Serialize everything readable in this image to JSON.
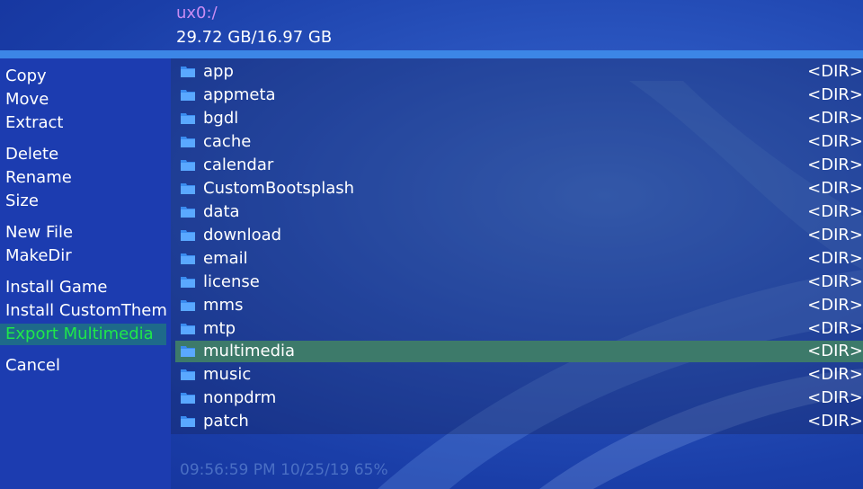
{
  "header": {
    "path": "ux0:/",
    "storage": "29.72 GB/16.97 GB"
  },
  "menu": {
    "items": [
      {
        "label": "Copy",
        "selected": false
      },
      {
        "label": "Move",
        "selected": false
      },
      {
        "label": "Extract",
        "selected": false
      },
      {
        "label": "Delete",
        "selected": false
      },
      {
        "label": "Rename",
        "selected": false
      },
      {
        "label": "Size",
        "selected": false
      },
      {
        "label": "New File",
        "selected": false
      },
      {
        "label": "MakeDir",
        "selected": false
      },
      {
        "label": "Install Game",
        "selected": false
      },
      {
        "label": "Install CustomTheme",
        "selected": false
      },
      {
        "label": "Export Multimedia",
        "selected": true
      },
      {
        "label": "Cancel",
        "selected": false
      }
    ]
  },
  "files": {
    "items": [
      {
        "name": "app",
        "type": "<DIR>",
        "icon": "folder-icon"
      },
      {
        "name": "appmeta",
        "type": "<DIR>",
        "icon": "folder-icon"
      },
      {
        "name": "bgdl",
        "type": "<DIR>",
        "icon": "folder-icon"
      },
      {
        "name": "cache",
        "type": "<DIR>",
        "icon": "folder-icon"
      },
      {
        "name": "calendar",
        "type": "<DIR>",
        "icon": "folder-icon"
      },
      {
        "name": "CustomBootsplash",
        "type": "<DIR>",
        "icon": "folder-icon"
      },
      {
        "name": "data",
        "type": "<DIR>",
        "icon": "folder-icon"
      },
      {
        "name": "download",
        "type": "<DIR>",
        "icon": "folder-icon"
      },
      {
        "name": "email",
        "type": "<DIR>",
        "icon": "folder-icon"
      },
      {
        "name": "license",
        "type": "<DIR>",
        "icon": "folder-icon"
      },
      {
        "name": "mms",
        "type": "<DIR>",
        "icon": "folder-icon"
      },
      {
        "name": "mtp",
        "type": "<DIR>",
        "icon": "folder-icon"
      },
      {
        "name": "multimedia",
        "type": "<DIR>",
        "icon": "folder-icon",
        "selected": true
      },
      {
        "name": "music",
        "type": "<DIR>",
        "icon": "folder-icon"
      },
      {
        "name": "nonpdrm",
        "type": "<DIR>",
        "icon": "folder-icon"
      },
      {
        "name": "patch",
        "type": "<DIR>",
        "icon": "folder-icon"
      }
    ]
  },
  "status": {
    "datetime_battery": "09:56:59 PM 10/25/19  65%"
  },
  "colors": {
    "path": "#c98cf2",
    "menu_selected_text": "#1ee84a",
    "row_selected": "#3d7a6a",
    "divider": "#3c86e6"
  }
}
